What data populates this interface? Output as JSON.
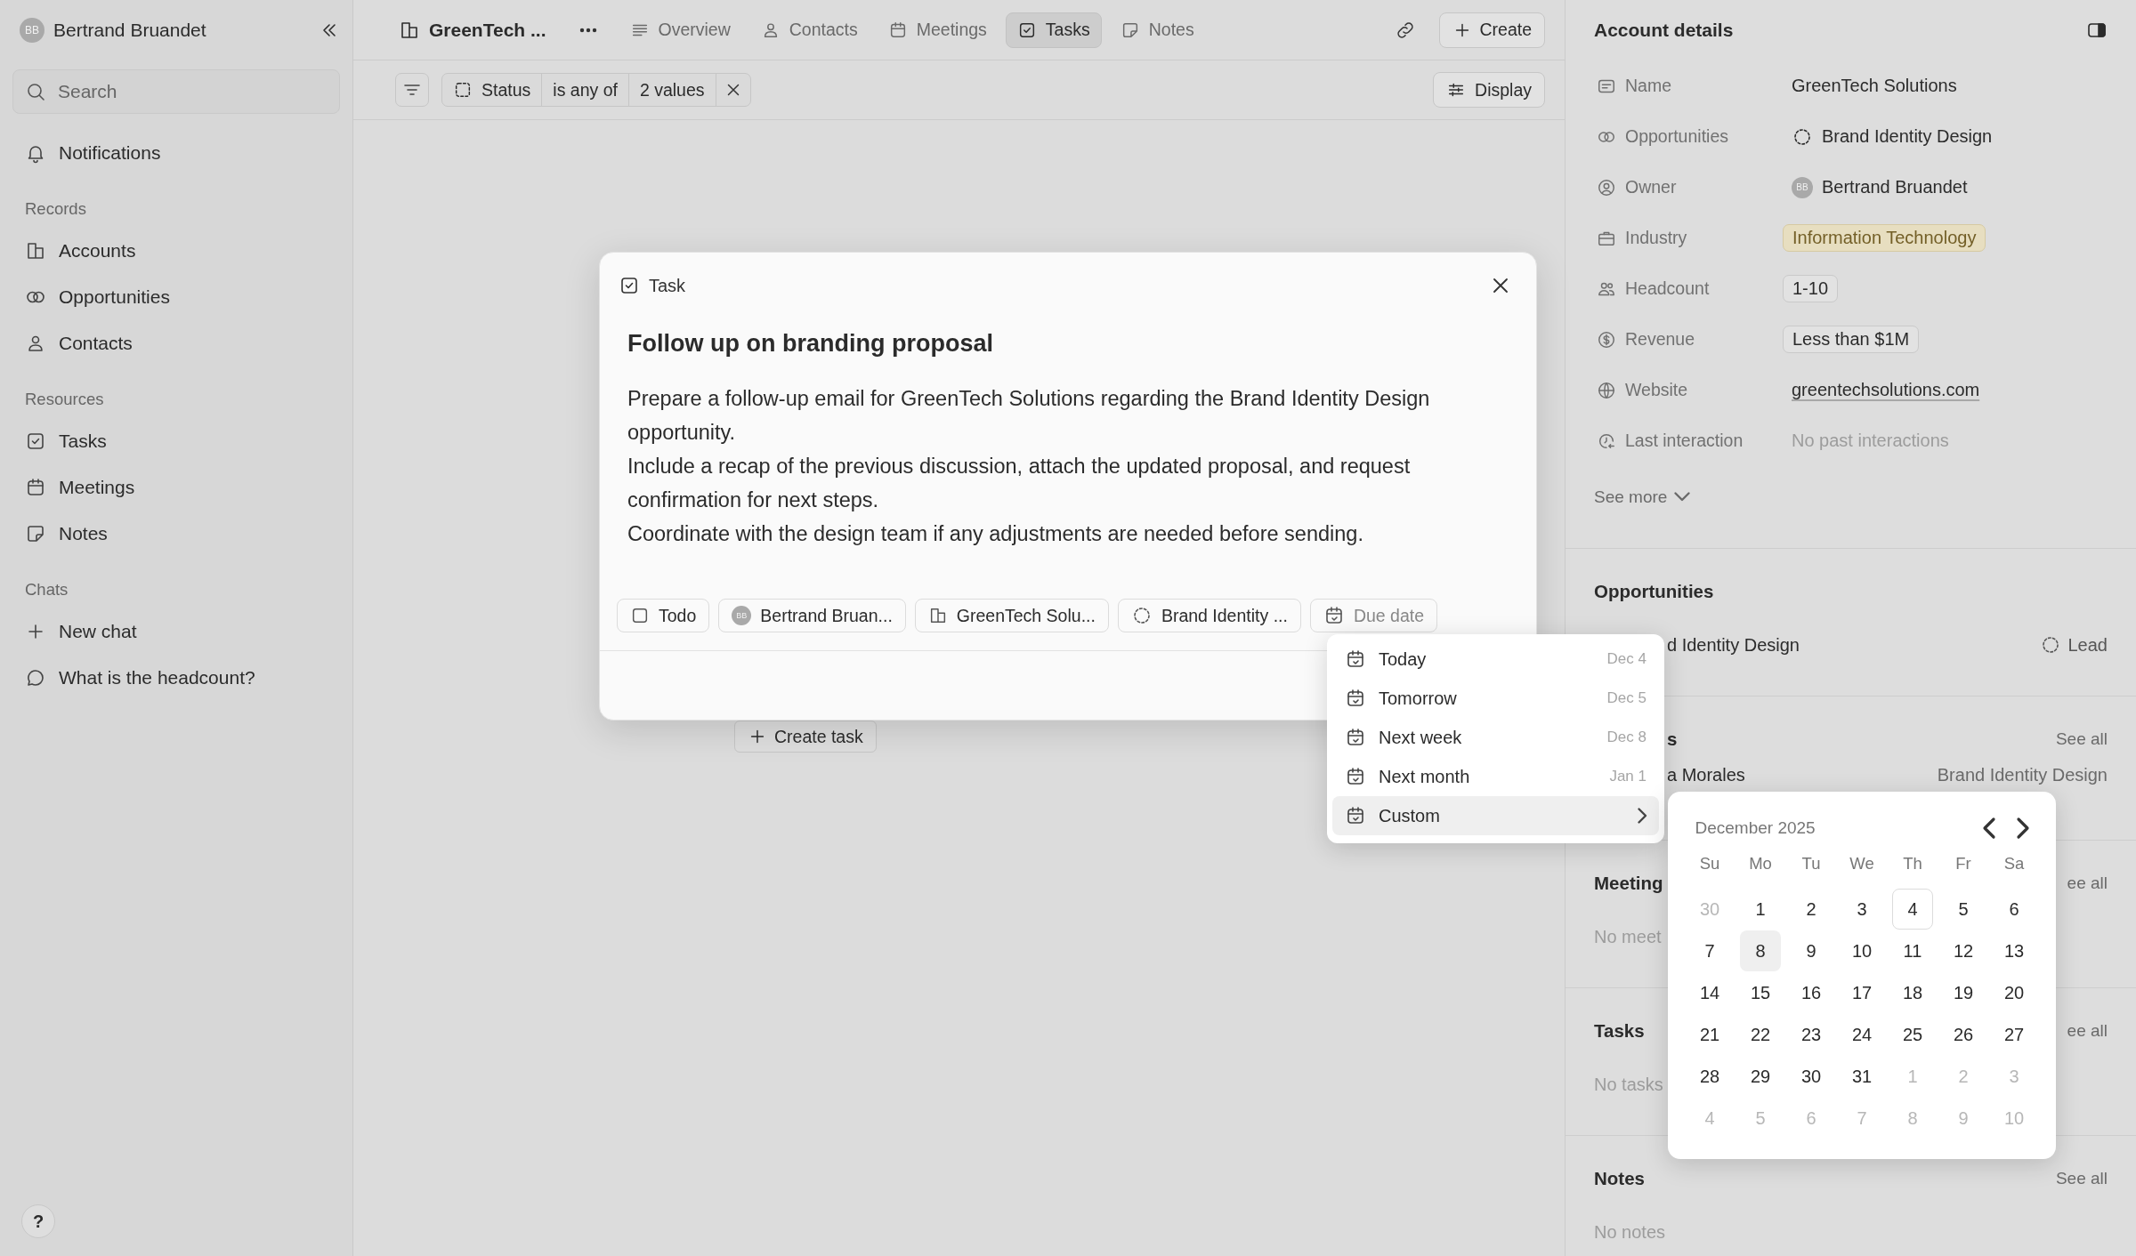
{
  "sidebar": {
    "user": {
      "initials": "BB",
      "name": "Bertrand Bruandet"
    },
    "search": {
      "placeholder": "Search"
    },
    "top_items": [
      {
        "label": "Notifications"
      }
    ],
    "sections": [
      {
        "title": "Records",
        "items": [
          {
            "label": "Accounts"
          },
          {
            "label": "Opportunities"
          },
          {
            "label": "Contacts"
          }
        ]
      },
      {
        "title": "Resources",
        "items": [
          {
            "label": "Tasks"
          },
          {
            "label": "Meetings"
          },
          {
            "label": "Notes"
          }
        ]
      },
      {
        "title": "Chats",
        "items": [
          {
            "label": "New chat"
          },
          {
            "label": "What is the headcount?"
          }
        ]
      }
    ],
    "help": "?"
  },
  "tabs": {
    "record": "GreenTech ...",
    "items": [
      {
        "label": "Overview",
        "selected": false
      },
      {
        "label": "Contacts",
        "selected": false
      },
      {
        "label": "Meetings",
        "selected": false
      },
      {
        "label": "Tasks",
        "selected": true
      },
      {
        "label": "Notes",
        "selected": false
      }
    ],
    "create": "Create"
  },
  "filter_bar": {
    "field": "Status",
    "operator": "is any of",
    "value": "2 values",
    "display": "Display"
  },
  "create_task": "Create task",
  "right_panel": {
    "title": "Account details",
    "fields": [
      {
        "label": "Name",
        "kind": "text",
        "value": "GreenTech Solutions"
      },
      {
        "label": "Opportunities",
        "kind": "opportunity",
        "value": "Brand Identity Design"
      },
      {
        "label": "Owner",
        "kind": "person",
        "initials": "BB",
        "value": "Bertrand Bruandet"
      },
      {
        "label": "Industry",
        "kind": "tag",
        "value": "Information Technology"
      },
      {
        "label": "Headcount",
        "kind": "chip",
        "value": "1-10"
      },
      {
        "label": "Revenue",
        "kind": "chip",
        "value": "Less than $1M"
      },
      {
        "label": "Website",
        "kind": "link",
        "value": "greentechsolutions.com"
      },
      {
        "label": "Last interaction",
        "kind": "empty",
        "value": "No past interactions"
      }
    ],
    "see_more": "See more",
    "sections": [
      {
        "kind": "opportunities",
        "title": "Opportunities",
        "rows": [
          {
            "name": "d Identity Design",
            "detail": "Lead"
          }
        ]
      },
      {
        "kind": "contacts",
        "title": "s",
        "see_all": "See all",
        "rows": [
          {
            "name": "a Morales",
            "detail": "Brand Identity Design"
          }
        ]
      },
      {
        "kind": "meetings",
        "title": "Meeting",
        "see_all": "ee all",
        "empty": "No meet"
      },
      {
        "kind": "tasks",
        "title": "Tasks",
        "see_all": "ee all",
        "empty": "No tasks"
      },
      {
        "kind": "notes",
        "title": "Notes",
        "see_all": "See all",
        "empty": "No notes"
      }
    ]
  },
  "modal": {
    "kind_label": "Task",
    "title": "Follow up on branding proposal",
    "description": [
      "Prepare a follow-up email for GreenTech Solutions regarding the Brand Identity Design opportunity.",
      "Include a recap of the previous discussion, attach the updated proposal, and request confirmation for next steps.",
      "Coordinate with the design team if any adjustments are needed before sending."
    ],
    "properties": [
      {
        "kind": "status",
        "label": "Todo",
        "checked": false
      },
      {
        "kind": "person",
        "initials": "BB",
        "label": "Bertrand Bruan..."
      },
      {
        "kind": "account",
        "label": "GreenTech Solu..."
      },
      {
        "kind": "opportunity",
        "label": "Brand Identity ..."
      },
      {
        "kind": "date",
        "label": "Due date"
      }
    ]
  },
  "due_menu": {
    "items": [
      {
        "label": "Today",
        "date": "Dec 4",
        "selected": false,
        "submenu": false
      },
      {
        "label": "Tomorrow",
        "date": "Dec 5",
        "selected": false,
        "submenu": false
      },
      {
        "label": "Next week",
        "date": "Dec 8",
        "selected": false,
        "submenu": false
      },
      {
        "label": "Next month",
        "date": "Jan 1",
        "selected": false,
        "submenu": false
      },
      {
        "label": "Custom",
        "selected": true,
        "submenu": true
      }
    ]
  },
  "calendar": {
    "month": "December 2025",
    "weekdays": [
      "Su",
      "Mo",
      "Tu",
      "We",
      "Th",
      "Fr",
      "Sa"
    ],
    "days": [
      {
        "label": "30",
        "outside": true,
        "today": false,
        "selected": false
      },
      {
        "label": "1",
        "outside": false,
        "today": false,
        "selected": false
      },
      {
        "label": "2",
        "outside": false,
        "today": false,
        "selected": false
      },
      {
        "label": "3",
        "outside": false,
        "today": false,
        "selected": false
      },
      {
        "label": "4",
        "outside": false,
        "today": true,
        "selected": false
      },
      {
        "label": "5",
        "outside": false,
        "today": false,
        "selected": false
      },
      {
        "label": "6",
        "outside": false,
        "today": false,
        "selected": false
      },
      {
        "label": "7",
        "outside": false,
        "today": false,
        "selected": false
      },
      {
        "label": "8",
        "outside": false,
        "today": false,
        "selected": true
      },
      {
        "label": "9",
        "outside": false,
        "today": false,
        "selected": false
      },
      {
        "label": "10",
        "outside": false,
        "today": false,
        "selected": false
      },
      {
        "label": "11",
        "outside": false,
        "today": false,
        "selected": false
      },
      {
        "label": "12",
        "outside": false,
        "today": false,
        "selected": false
      },
      {
        "label": "13",
        "outside": false,
        "today": false,
        "selected": false
      },
      {
        "label": "14",
        "outside": false,
        "today": false,
        "selected": false
      },
      {
        "label": "15",
        "outside": false,
        "today": false,
        "selected": false
      },
      {
        "label": "16",
        "outside": false,
        "today": false,
        "selected": false
      },
      {
        "label": "17",
        "outside": false,
        "today": false,
        "selected": false
      },
      {
        "label": "18",
        "outside": false,
        "today": false,
        "selected": false
      },
      {
        "label": "19",
        "outside": false,
        "today": false,
        "selected": false
      },
      {
        "label": "20",
        "outside": false,
        "today": false,
        "selected": false
      },
      {
        "label": "21",
        "outside": false,
        "today": false,
        "selected": false
      },
      {
        "label": "22",
        "outside": false,
        "today": false,
        "selected": false
      },
      {
        "label": "23",
        "outside": false,
        "today": false,
        "selected": false
      },
      {
        "label": "24",
        "outside": false,
        "today": false,
        "selected": false
      },
      {
        "label": "25",
        "outside": false,
        "today": false,
        "selected": false
      },
      {
        "label": "26",
        "outside": false,
        "today": false,
        "selected": false
      },
      {
        "label": "27",
        "outside": false,
        "today": false,
        "selected": false
      },
      {
        "label": "28",
        "outside": false,
        "today": false,
        "selected": false
      },
      {
        "label": "29",
        "outside": false,
        "today": false,
        "selected": false
      },
      {
        "label": "30",
        "outside": false,
        "today": false,
        "selected": false
      },
      {
        "label": "31",
        "outside": false,
        "today": false,
        "selected": false
      },
      {
        "label": "1",
        "outside": true,
        "today": false,
        "selected": false
      },
      {
        "label": "2",
        "outside": true,
        "today": false,
        "selected": false
      },
      {
        "label": "3",
        "outside": true,
        "today": false,
        "selected": false
      },
      {
        "label": "4",
        "outside": true,
        "today": false,
        "selected": false
      },
      {
        "label": "5",
        "outside": true,
        "today": false,
        "selected": false
      },
      {
        "label": "6",
        "outside": true,
        "today": false,
        "selected": false
      },
      {
        "label": "7",
        "outside": true,
        "today": false,
        "selected": false
      },
      {
        "label": "8",
        "outside": true,
        "today": false,
        "selected": false
      },
      {
        "label": "9",
        "outside": true,
        "today": false,
        "selected": false
      },
      {
        "label": "10",
        "outside": true,
        "today": false,
        "selected": false
      }
    ]
  }
}
